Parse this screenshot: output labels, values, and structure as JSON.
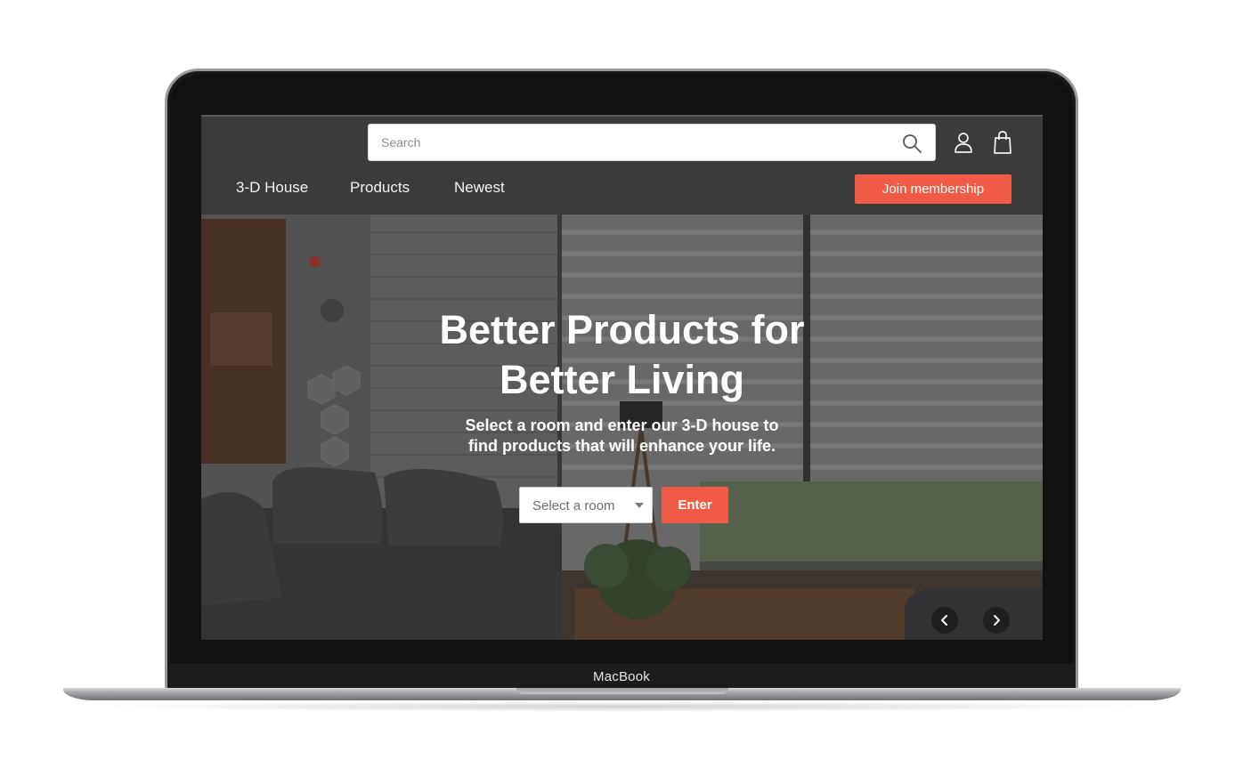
{
  "device": {
    "label": "MacBook"
  },
  "header": {
    "search_placeholder": "Search",
    "nav": [
      {
        "label": "3-D House"
      },
      {
        "label": "Products"
      },
      {
        "label": "Newest"
      }
    ],
    "join_label": "Join membership"
  },
  "hero": {
    "title_line1": "Better Products for",
    "title_line2": "Better Living",
    "subtitle_line1": "Select a room and enter our 3-D house to",
    "subtitle_line2": "find products that will enhance your life.",
    "room_select_value": "Select a room",
    "enter_label": "Enter"
  },
  "colors": {
    "accent": "#f05b46",
    "topbar": "#3b3b3c"
  },
  "icons": [
    "search-icon",
    "user-icon",
    "shopping-bag-icon",
    "caret-down-icon",
    "chevron-left-icon",
    "chevron-right-icon"
  ]
}
